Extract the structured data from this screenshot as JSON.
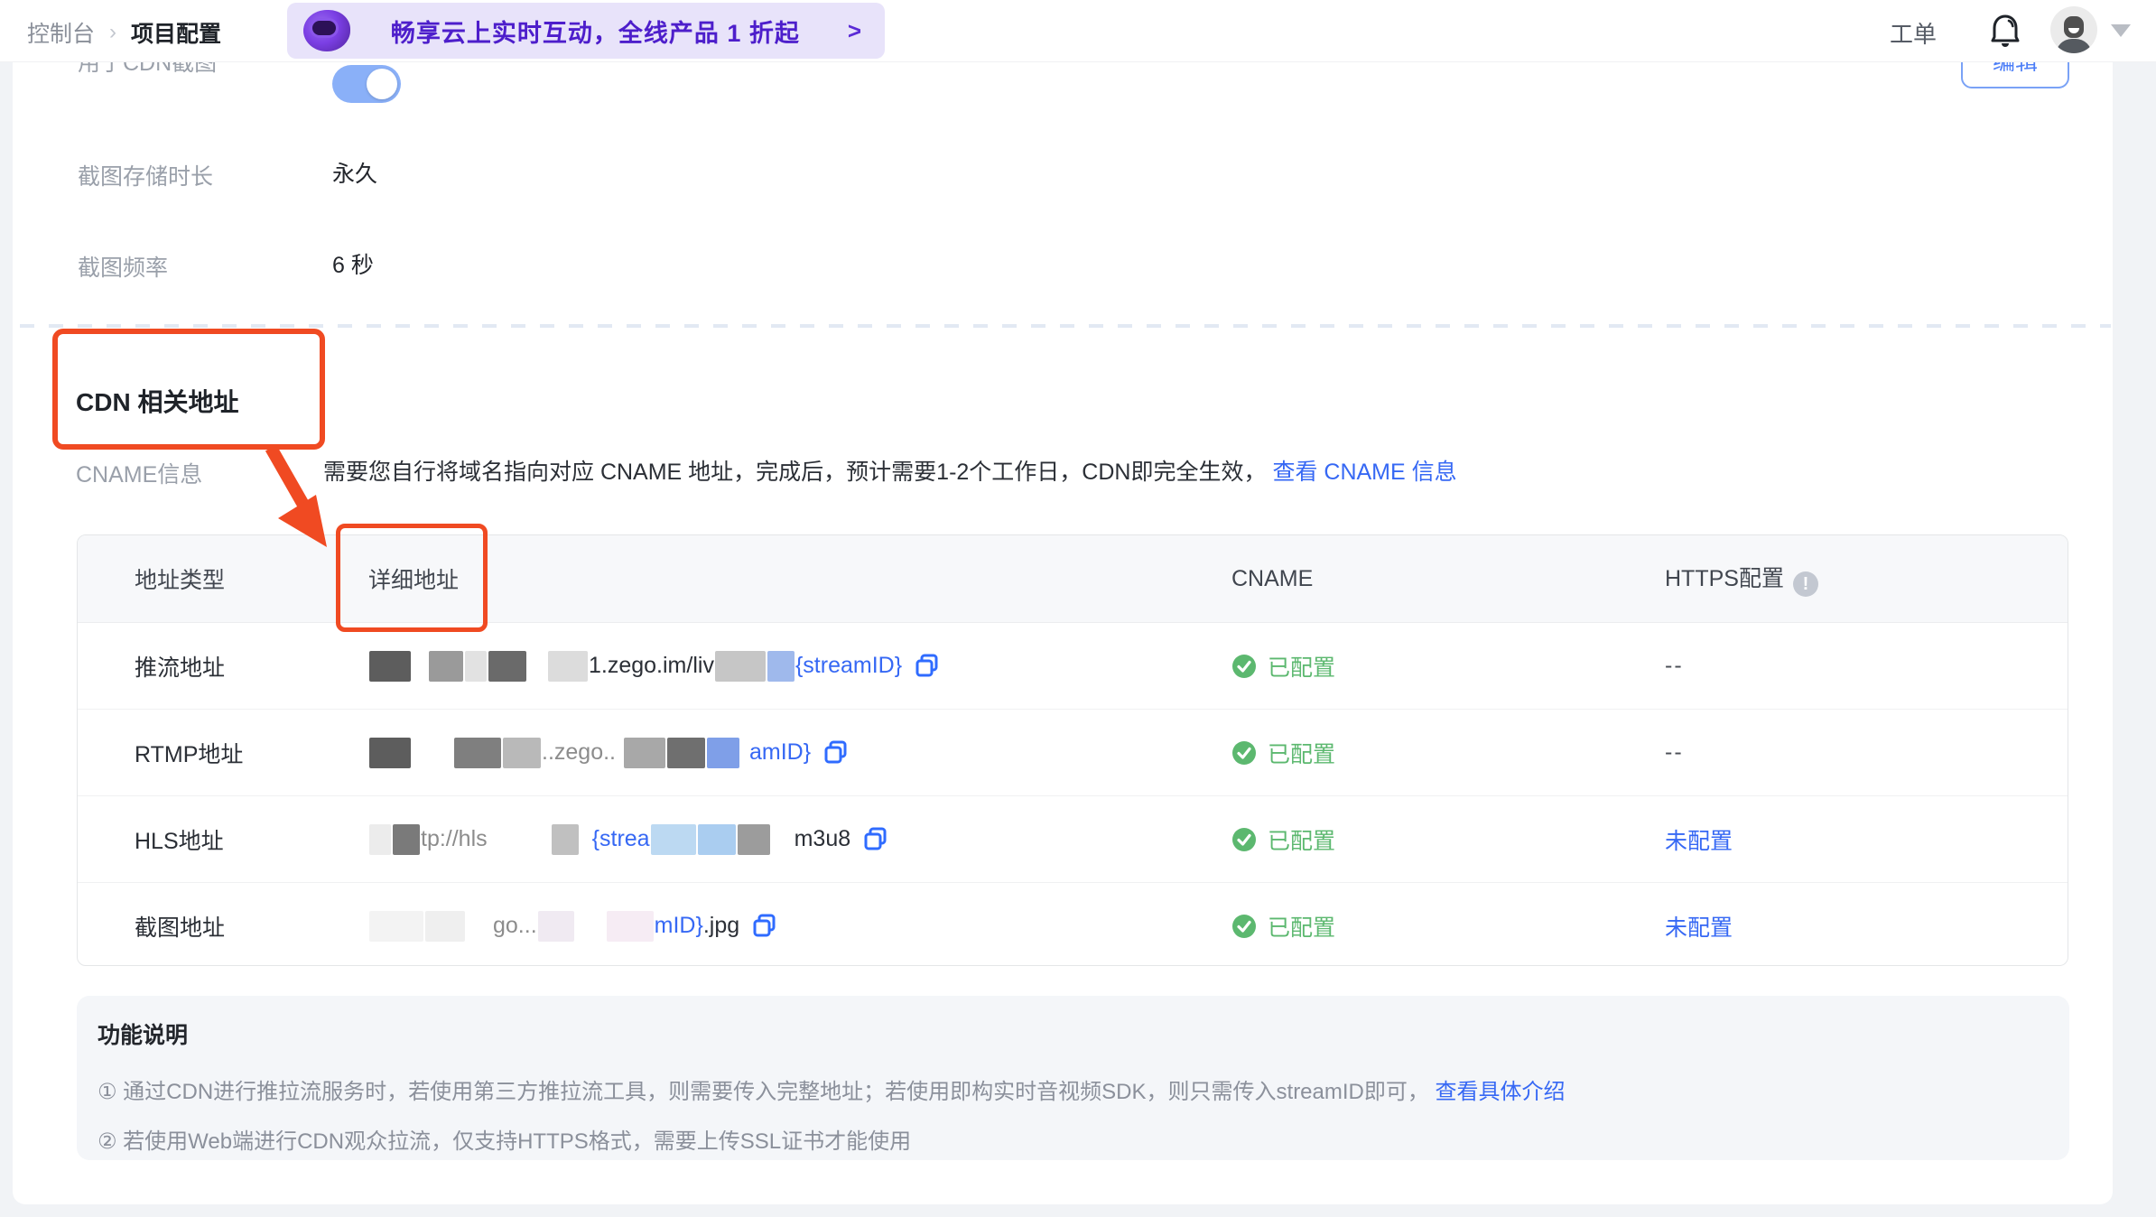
{
  "topbar": {
    "breadcrumb": {
      "parent": "控制台",
      "separator": "›",
      "current": "项目配置"
    },
    "banner": {
      "text": "畅享云上实时互动，全线产品 1 折起",
      "arrow": ">",
      "bg": "#e8e3fa",
      "text_color": "#4d1ecb"
    },
    "ticket_label": "工单"
  },
  "settings": {
    "row_toggle": {
      "label": "用于CDN截图",
      "state": "on"
    },
    "row_storage": {
      "label": "截图存储时长",
      "value": "永久"
    },
    "row_frequency": {
      "label": "截图频率",
      "value": "6 秒"
    },
    "edit_button": "编辑"
  },
  "cdn_section": {
    "title": "CDN 相关地址",
    "cname_label": "CNAME信息",
    "cname_desc": "需要您自行将域名指向对应 CNAME 地址，完成后，预计需要1-2个工作日，CDN即完全生效，",
    "cname_link": "查看 CNAME 信息"
  },
  "table": {
    "headers": {
      "type": "地址类型",
      "detail": "详细地址",
      "cname": "CNAME",
      "https": "HTTPS配置"
    },
    "https_info_icon": "!",
    "rows": [
      {
        "type": "推流地址",
        "url_segments": [
          {
            "block": 46,
            "c": "#5d5d5d"
          },
          {
            "gap": 18
          },
          {
            "block": 38,
            "c": "#9a9a9a"
          },
          {
            "block": 24,
            "c": "#e2e2e2"
          },
          {
            "block": 42,
            "c": "#6a6a6a"
          },
          {
            "gap": 22
          },
          {
            "block": 44,
            "c": "#dcdcdc"
          },
          {
            "text": "1.zego.im/liv",
            "c": "dark"
          },
          {
            "block": 56,
            "c": "#c6c6c6"
          },
          {
            "block": 30,
            "c": "#9fb9ec"
          },
          {
            "text": "{streamID}",
            "c": "blue"
          }
        ],
        "cname": "已配置",
        "https": "--",
        "https_is_link": false
      },
      {
        "type": "RTMP地址",
        "url_segments": [
          {
            "block": 46,
            "c": "#5d5d5d"
          },
          {
            "gap": 46
          },
          {
            "block": 52,
            "c": "#7f7f7f"
          },
          {
            "block": 42,
            "c": "#b9b9b9"
          },
          {
            "text": "..zego..",
            "c": "gray"
          },
          {
            "gap": 8
          },
          {
            "block": 46,
            "c": "#a8a8a8"
          },
          {
            "block": 42,
            "c": "#6f6f6f"
          },
          {
            "block": 36,
            "c": "#7f9fe8"
          },
          {
            "gap": 10
          },
          {
            "text": "amID}",
            "c": "blue"
          }
        ],
        "cname": "已配置",
        "https": "--",
        "https_is_link": false
      },
      {
        "type": "HLS地址",
        "url_segments": [
          {
            "block": 24,
            "c": "#ececec"
          },
          {
            "block": 30,
            "c": "#7a7a7a"
          },
          {
            "text": "tp://hls",
            "c": "gray"
          },
          {
            "gap": 70
          },
          {
            "block": 30,
            "c": "#c0c0c0"
          },
          {
            "gap": 14
          },
          {
            "text": "{strea",
            "c": "blue"
          },
          {
            "block": 50,
            "c": "#bcd9f2"
          },
          {
            "block": 42,
            "c": "#aacdf0"
          },
          {
            "block": 36,
            "c": "#9c9c9c"
          },
          {
            "gap": 26
          },
          {
            "text": "m3u8",
            "c": "dark"
          }
        ],
        "cname": "已配置",
        "https": "未配置",
        "https_is_link": true
      },
      {
        "type": "截图地址",
        "url_segments": [
          {
            "block": 60,
            "c": "#f3f3f3"
          },
          {
            "block": 44,
            "c": "#efefef"
          },
          {
            "gap": 30
          },
          {
            "text": "go...",
            "c": "gray"
          },
          {
            "block": 40,
            "c": "#f0eaf2"
          },
          {
            "gap": 34
          },
          {
            "block": 52,
            "c": "#f6ecf4"
          },
          {
            "text": "mID}",
            "c": "blue"
          },
          {
            "text": ".jpg",
            "c": "dark"
          }
        ],
        "cname": "已配置",
        "https": "未配置",
        "https_is_link": true
      }
    ]
  },
  "notes": {
    "title": "功能说明",
    "line1_prefix": "① 通过CDN进行推拉流服务时，若使用第三方推拉流工具，则需要传入完整地址；若使用即构实时音视频SDK，则只需传入streamID即可，",
    "line1_link": "查看具体介绍",
    "line2": "② 若使用Web端进行CDN观众拉流，仅支持HTTPS格式，需要上传SSL证书才能使用"
  },
  "colors": {
    "link_blue": "#3668f4",
    "copy_icon_blue": "#2f6bff",
    "success_green": "#5cb86f",
    "annotation_red": "#f04a22",
    "toggle_on_blue": "#8ab0f8",
    "banner_purple": "#4d1ecb"
  }
}
